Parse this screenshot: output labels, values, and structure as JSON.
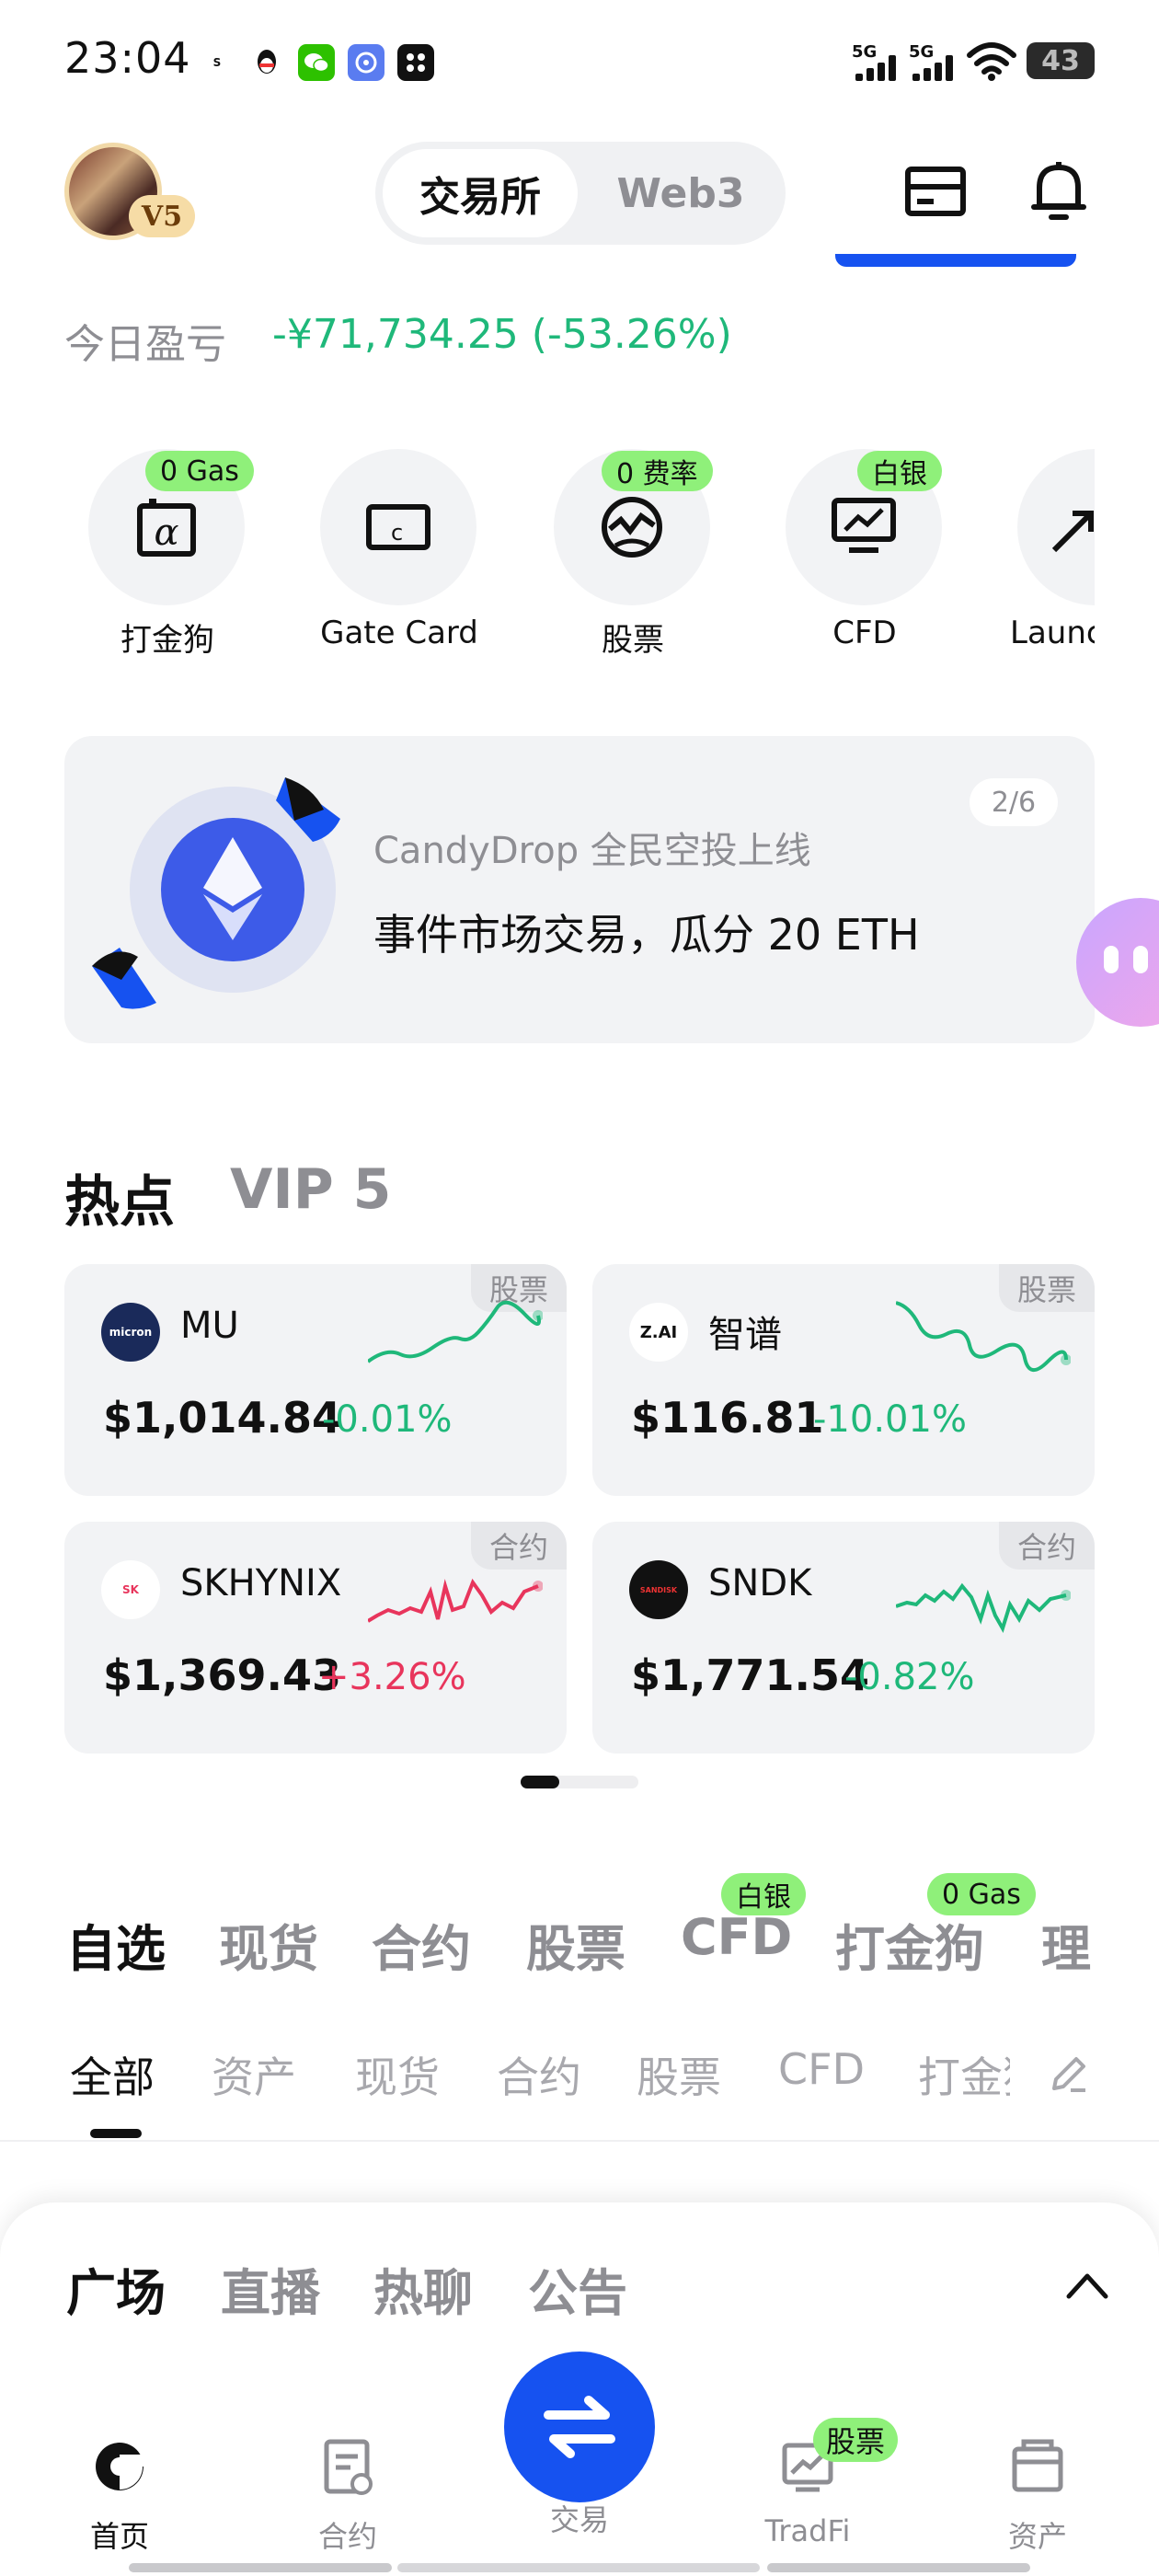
{
  "status_bar": {
    "time": "23:04",
    "net1": "5G",
    "net2": "5G",
    "battery": "43"
  },
  "header": {
    "vip_badge": "V5",
    "seg_active": "交易所",
    "seg_inactive": "Web3"
  },
  "pnl": {
    "label": "今日盈亏",
    "value": "-¥71,734.25 (-53.26%)"
  },
  "quick": [
    {
      "label": "打金狗",
      "tag": "0 Gas",
      "icon": "dajingou-icon"
    },
    {
      "label": "Gate Card",
      "tag": "",
      "icon": "card-icon"
    },
    {
      "label": "股票",
      "tag": "0 费率",
      "icon": "stocks-globe-icon"
    },
    {
      "label": "CFD",
      "tag": "白银",
      "icon": "chart-monitor-icon"
    },
    {
      "label": "Launc",
      "tag": "",
      "icon": "launch-icon"
    }
  ],
  "banner": {
    "pager": "2/6",
    "subtitle": "CandyDrop 全民空投上线",
    "title": "事件市场交易，瓜分 20 ETH"
  },
  "hot": {
    "title": "热点",
    "vip": "VIP 5",
    "cards": [
      {
        "name": "MU",
        "tag": "股票",
        "price": "$1,014.84",
        "change": "-0.01%",
        "logo": "micron",
        "color": "#1fb87a"
      },
      {
        "name": "智谱",
        "tag": "股票",
        "price": "$116.81",
        "change": "-10.01%",
        "logo": "Z.AI",
        "color": "#1fb87a"
      },
      {
        "name": "SKHYNIX",
        "tag": "合约",
        "price": "$1,369.43",
        "change": "+3.26%",
        "logo": "SK hynix",
        "color": "#e8355c"
      },
      {
        "name": "SNDK",
        "tag": "合约",
        "price": "$1,771.54",
        "change": "-0.82%",
        "logo": "SANDISK",
        "color": "#1fb87a"
      }
    ]
  },
  "tabs": [
    {
      "label": "自选",
      "tag": ""
    },
    {
      "label": "现货",
      "tag": ""
    },
    {
      "label": "合约",
      "tag": ""
    },
    {
      "label": "股票",
      "tag": ""
    },
    {
      "label": "CFD",
      "tag": "白银"
    },
    {
      "label": "打金狗",
      "tag": "0 Gas"
    },
    {
      "label": "理",
      "tag": ""
    }
  ],
  "subtabs": [
    "全部",
    "资产",
    "现货",
    "合约",
    "股票",
    "CFD",
    "打金狗"
  ],
  "sheet_tabs": [
    "广场",
    "直播",
    "热聊",
    "公告"
  ],
  "nav": [
    {
      "label": "首页",
      "icon": "home-icon"
    },
    {
      "label": "合约",
      "icon": "futures-icon"
    },
    {
      "label": "交易",
      "icon": "swap-icon"
    },
    {
      "label": "TradFi",
      "icon": "tradfi-icon",
      "tag": "股票"
    },
    {
      "label": "资产",
      "icon": "wallet-icon"
    }
  ],
  "colors": {
    "accent": "#1652f0",
    "up": "#e8355c",
    "down": "#1fb87a",
    "tag_green": "#8ff07a"
  }
}
